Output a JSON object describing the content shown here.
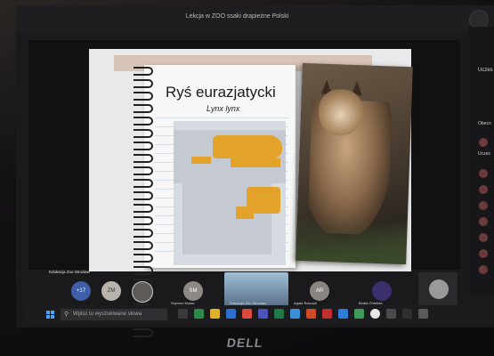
{
  "window": {
    "title": "Lekcja w ZOO ssaki drapieżne Polski"
  },
  "slide": {
    "title": "Ryś eurazjatycki",
    "subtitle": "Lynx lynx",
    "presenter_label": "Edukacja Zoo Wrocław"
  },
  "participants": [
    {
      "initials": "+17",
      "name": ""
    },
    {
      "initials": "ZM",
      "name": ""
    },
    {
      "initials": "",
      "name": ""
    },
    {
      "initials": "SM",
      "name": "Szymon Mutas"
    },
    {
      "initials": "",
      "name": "Edukacja Zoo Wrocław"
    },
    {
      "initials": "AR",
      "name": "Agata Rarczyk"
    },
    {
      "initials": "",
      "name": "Beata Chlebda"
    },
    {
      "initials": "",
      "name": ""
    }
  ],
  "side_panel": {
    "heading": "Uczes",
    "sections": [
      "Obecn",
      "Uczes"
    ]
  },
  "taskbar": {
    "search_placeholder": "Wpisz tu wyszukiwane słowa"
  },
  "device_logo": "DELL",
  "colors": {
    "range": "#e3a32a",
    "map_water": "#d6dbe2",
    "accent": "#4aa3ff"
  },
  "icons": [
    "windows-start-icon",
    "search-icon",
    "record-icon"
  ]
}
